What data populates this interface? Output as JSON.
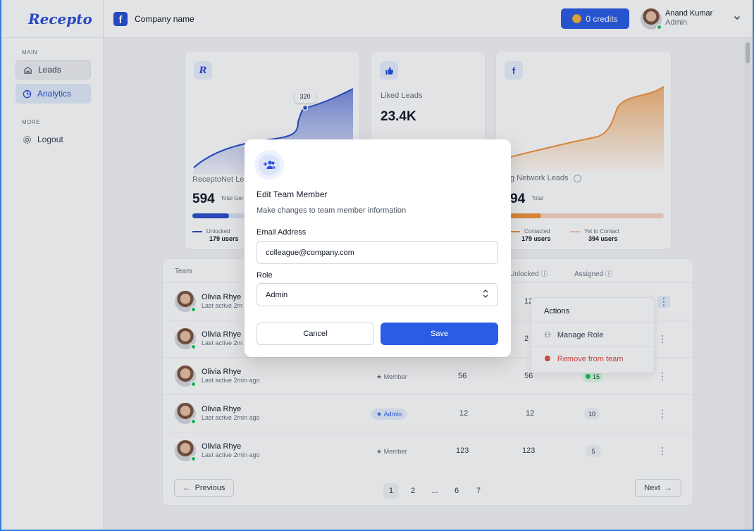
{
  "app": {
    "logo_text": "Recepto"
  },
  "sidebar": {
    "sections": [
      {
        "label": "MAIN",
        "items": [
          {
            "label": "Leads",
            "icon": "home-icon"
          },
          {
            "label": "Analytics",
            "icon": "pie-chart-icon"
          }
        ]
      },
      {
        "label": "MORE",
        "items": [
          {
            "label": "Logout",
            "icon": "gear-icon"
          }
        ]
      }
    ]
  },
  "topbar": {
    "company_icon": "facebook-icon",
    "company_name": "Company name",
    "credits_label": "0 credits",
    "user": {
      "name": "Anand Kumar",
      "role": "Admin"
    }
  },
  "cards": [
    {
      "icon": "recepto-logo-icon",
      "title": "ReceptoNet Le",
      "value": "594",
      "value_label": "Total Ger",
      "tooltip": "320",
      "legend": [
        {
          "label": "Unlocked",
          "value": "179 users",
          "color": "#2b4fc9"
        }
      ],
      "accent": "#4865d4"
    },
    {
      "icon": "thumbs-up-icon",
      "title": "Liked Leads",
      "value": "23.4K"
    },
    {
      "icon": "facebook-icon",
      "title": "g Network Leads",
      "value": "94",
      "value_label": "Total",
      "legend": [
        {
          "label": "Contacted",
          "value": "179 users",
          "color": "#f0943a"
        },
        {
          "label": "Yet to Contact",
          "value": "394 users",
          "color": "#f6c9b5"
        }
      ],
      "accent": "#f0943a"
    }
  ],
  "table": {
    "headers": {
      "team": "Team",
      "unlocked": "Unlocked",
      "assigned": "Assigned"
    },
    "rows": [
      {
        "name": "Olivia Rhye",
        "active": "Last active 2m",
        "role": "",
        "c1": "",
        "c2": "12",
        "assigned": ""
      },
      {
        "name": "Olivia Rhye",
        "active": "Last active 2m",
        "role": "",
        "c1": "",
        "c2": "2",
        "assigned": ""
      },
      {
        "name": "Olivia Rhye",
        "active": "Last active 2min ago",
        "role": "Member",
        "c1": "56",
        "c2": "56",
        "assigned": "15"
      },
      {
        "name": "Olivia Rhye",
        "active": "Last active 2min ago",
        "role": "Admin",
        "c1": "12",
        "c2": "12",
        "assigned": "10"
      },
      {
        "name": "Olivia Rhye",
        "active": "Last active 2min ago",
        "role": "Member",
        "c1": "123",
        "c2": "123",
        "assigned": "5"
      }
    ],
    "pagination": {
      "previous": "Previous",
      "next": "Next",
      "pages": [
        "1",
        "2",
        "...",
        "6",
        "7"
      ]
    }
  },
  "actions_menu": {
    "title": "Actions",
    "items": [
      {
        "label": "Manage Role",
        "icon": "user-gear-icon"
      },
      {
        "label": "Remove from team",
        "icon": "user-remove-icon"
      }
    ]
  },
  "modal": {
    "icon": "add-user-icon",
    "title": "Edit Team Member",
    "subtitle": "Make changes to team member information",
    "email_label": "Email Address",
    "email_value": "colleague@company.com",
    "role_label": "Role",
    "role_value": "Admin",
    "cancel_label": "Cancel",
    "save_label": "Save"
  },
  "colors": {
    "primary": "#2b5ce6",
    "success": "#22c55e",
    "danger": "#e0453f",
    "orange": "#f0943a"
  }
}
